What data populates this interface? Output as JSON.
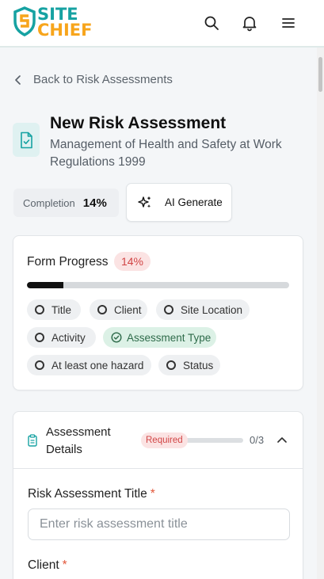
{
  "header": {
    "logo_top": "SITE",
    "logo_bottom": "CHIEF",
    "brand_colors": {
      "teal": "#16a2a2",
      "orange": "#f7a51c"
    },
    "icons": [
      "search-icon",
      "bell-icon",
      "menu-icon"
    ]
  },
  "nav": {
    "back_label": "Back to Risk Assessments"
  },
  "page": {
    "title": "New Risk Assessment",
    "subtitle": "Management of Health and Safety at Work Regulations 1999"
  },
  "completion": {
    "label": "Completion",
    "value": "14%"
  },
  "ai_button": {
    "label": "AI Generate"
  },
  "form_progress": {
    "title": "Form Progress",
    "badge": "14%",
    "progress": 0.14,
    "chips": [
      {
        "label": "Title",
        "done": false
      },
      {
        "label": "Client",
        "done": false
      },
      {
        "label": "Site Location",
        "done": false
      },
      {
        "label": "Activity",
        "done": false
      },
      {
        "label": "Assessment Type",
        "done": true
      },
      {
        "label": "At least one hazard",
        "done": false
      },
      {
        "label": "Status",
        "done": false
      }
    ]
  },
  "assessment_details": {
    "title": "Assessment Details",
    "required_badge": "Required",
    "count": "0/3",
    "progress": 0,
    "fields": {
      "title_label": "Risk Assessment Title",
      "title_placeholder": "Enter risk assessment title",
      "title_value": "",
      "client_label": "Client",
      "required_marker": "*"
    }
  }
}
